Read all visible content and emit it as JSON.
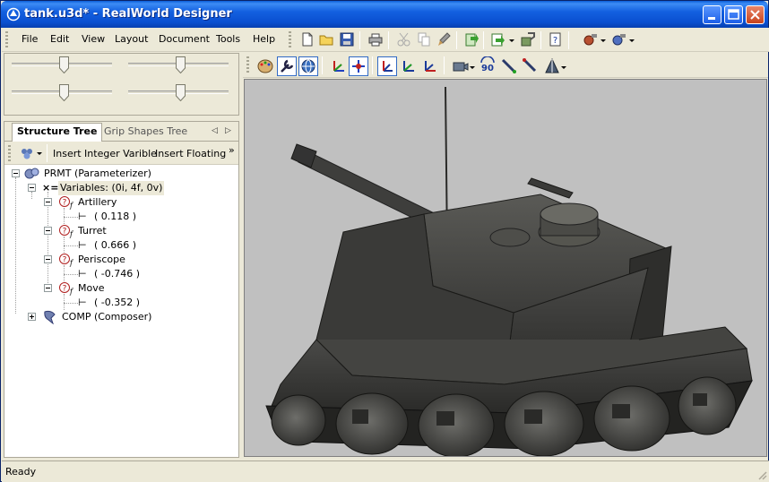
{
  "window": {
    "title": "tank.u3d* - RealWorld Designer"
  },
  "menu": {
    "items": [
      "File",
      "Edit",
      "View",
      "Layout",
      "Document",
      "Tools",
      "Help"
    ]
  },
  "tabs": {
    "structure": "Structure Tree",
    "grip": "Grip Shapes Tree"
  },
  "treebar": {
    "insert_integer": "Insert Integer Varible",
    "insert_floating": "Insert Floating",
    "more": "»"
  },
  "tree": {
    "root": "PRMT (Parameterizer)",
    "variables": "Variables: (0i, 4f, 0v)",
    "vars": [
      {
        "name": "Artillery",
        "value": "( 0.118 )"
      },
      {
        "name": "Turret",
        "value": "( 0.666 )"
      },
      {
        "name": "Periscope",
        "value": "( -0.746 )"
      },
      {
        "name": "Move",
        "value": "( -0.352 )"
      }
    ],
    "composer": "COMP (Composer)"
  },
  "sliders": [
    {
      "name": "slider-1",
      "value": 0.5
    },
    {
      "name": "slider-2",
      "value": 0.5
    },
    {
      "name": "slider-3",
      "value": 0.5
    },
    {
      "name": "slider-4",
      "value": 0.5
    }
  ],
  "status": {
    "text": "Ready"
  },
  "viewport": {
    "model": "tank",
    "background": "#c0c0c0"
  },
  "colors": {
    "titlebar": "#0a4fd0",
    "accent": "#316ac5",
    "panel": "#ece9d8"
  }
}
